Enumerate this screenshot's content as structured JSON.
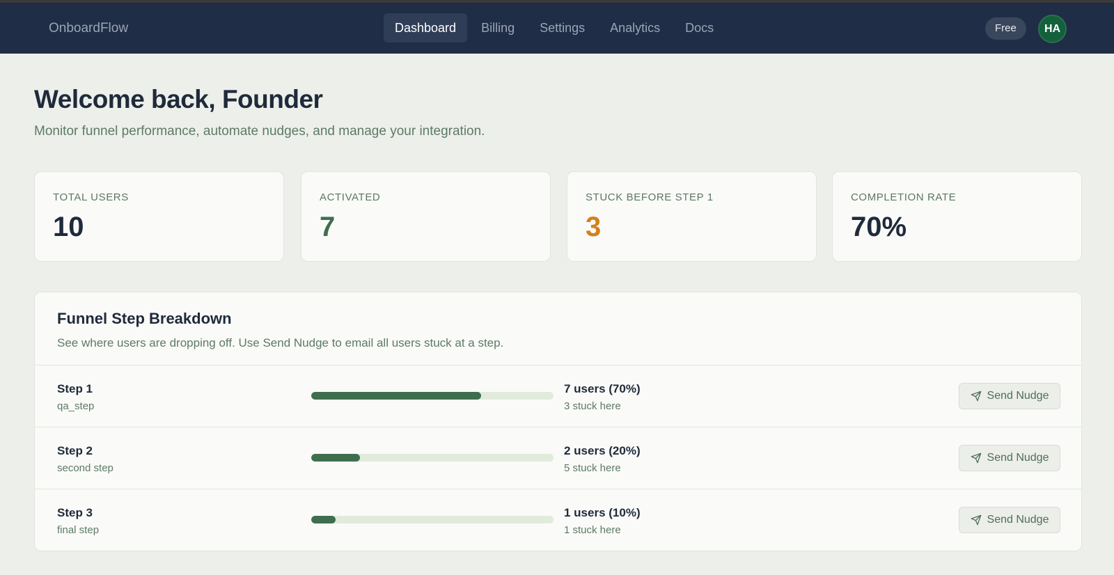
{
  "app": {
    "brand": "OnboardFlow"
  },
  "nav": {
    "tabs": [
      {
        "label": "Dashboard",
        "active": true
      },
      {
        "label": "Billing",
        "active": false
      },
      {
        "label": "Settings",
        "active": false
      },
      {
        "label": "Analytics",
        "active": false
      },
      {
        "label": "Docs",
        "active": false
      }
    ],
    "plan_badge": "Free",
    "avatar_initials": "HA"
  },
  "header": {
    "title": "Welcome back, Founder",
    "subtitle": "Monitor funnel performance, automate nudges, and manage your integration."
  },
  "stats": [
    {
      "label": "TOTAL USERS",
      "value": "10"
    },
    {
      "label": "ACTIVATED",
      "value": "7"
    },
    {
      "label": "STUCK BEFORE STEP 1",
      "value": "3"
    },
    {
      "label": "COMPLETION RATE",
      "value": "70%"
    }
  ],
  "funnel": {
    "title": "Funnel Step Breakdown",
    "description": "See where users are dropping off. Use Send Nudge to email all users stuck at a step.",
    "button_label": "Send Nudge",
    "steps": [
      {
        "name": "Step 1",
        "key": "qa_step",
        "users": "7 users (70%)",
        "stuck": "3 stuck here",
        "progress": 0.7
      },
      {
        "name": "Step 2",
        "key": "second step",
        "users": "2 users (20%)",
        "stuck": "5 stuck here",
        "progress": 0.2
      },
      {
        "name": "Step 3",
        "key": "final step",
        "users": "1 users (10%)",
        "stuck": "1 stuck here",
        "progress": 0.1
      }
    ]
  },
  "colors": {
    "navbar": "#1f2d47",
    "accent_green": "#3f6e4f",
    "warning_orange": "#d4801b",
    "avatar_green": "#14603c"
  },
  "icons": {
    "nudge": "send-icon"
  }
}
